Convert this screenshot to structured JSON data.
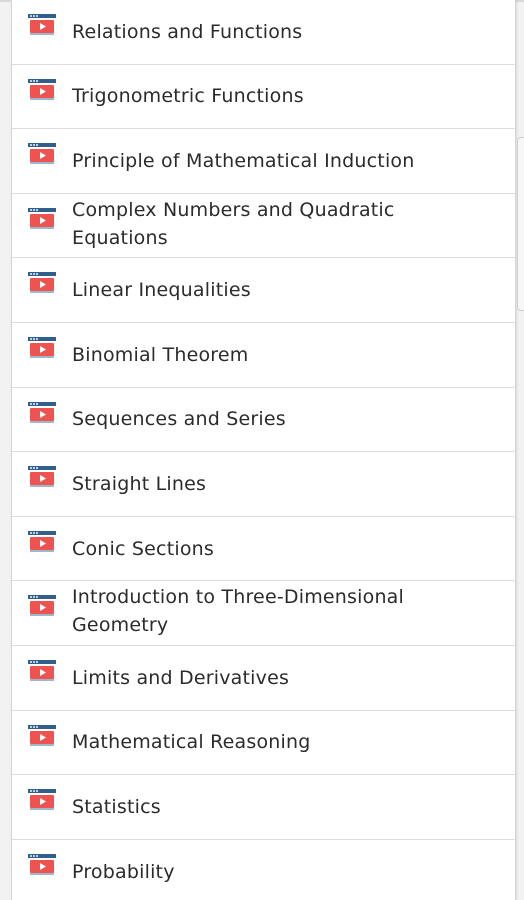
{
  "chapters": [
    {
      "label": "Relations and Functions",
      "icon": "chapter-video-icon"
    },
    {
      "label": "Trigonometric Functions",
      "icon": "chapter-video-icon"
    },
    {
      "label": "Principle of Mathematical Induction",
      "icon": "chapter-video-icon"
    },
    {
      "label": "Complex Numbers and Quadratic Equations",
      "icon": "chapter-video-icon"
    },
    {
      "label": "Linear Inequalities",
      "icon": "chapter-video-icon"
    },
    {
      "label": "Binomial Theorem",
      "icon": "chapter-video-icon"
    },
    {
      "label": "Sequences and Series",
      "icon": "chapter-video-icon"
    },
    {
      "label": "Straight Lines",
      "icon": "chapter-video-icon"
    },
    {
      "label": "Conic Sections",
      "icon": "chapter-video-icon"
    },
    {
      "label": "Introduction to Three-Dimensional Geometry",
      "icon": "chapter-video-icon"
    },
    {
      "label": "Limits and Derivatives",
      "icon": "chapter-video-icon"
    },
    {
      "label": "Mathematical Reasoning",
      "icon": "chapter-video-icon"
    },
    {
      "label": "Statistics",
      "icon": "chapter-video-icon"
    },
    {
      "label": "Probability",
      "icon": "chapter-video-icon"
    }
  ],
  "colors": {
    "icon_red": "#ef5350",
    "icon_bar": "#2f5f8a",
    "text": "#2b2b2b",
    "divider": "#dcdcdc"
  }
}
